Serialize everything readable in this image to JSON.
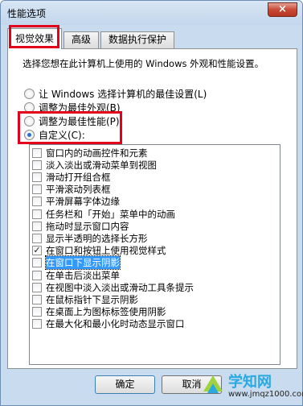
{
  "window": {
    "title": "性能选项",
    "close_label": "×"
  },
  "tabs": [
    "视觉效果",
    "高级",
    "数据执行保护"
  ],
  "panel": {
    "description": "选择您想在此计算机上使用的 Windows 外观和性能设置。",
    "radios": [
      {
        "label": "让 Windows 选择计算机的最佳设置(L)",
        "checked": false
      },
      {
        "label": "调整为最佳外观(B)",
        "checked": false
      },
      {
        "label": "调整为最佳性能(P)",
        "checked": false
      },
      {
        "label": "自定义(C):",
        "checked": true
      }
    ],
    "options": [
      {
        "label": "窗口内的动画控件和元素",
        "checked": false
      },
      {
        "label": "淡入淡出或滑动菜单到视图",
        "checked": false
      },
      {
        "label": "滑动打开组合框",
        "checked": false
      },
      {
        "label": "平滑滚动列表框",
        "checked": false
      },
      {
        "label": "平滑屏幕字体边缘",
        "checked": false
      },
      {
        "label": "任务栏和「开始」菜单中的动画",
        "checked": false
      },
      {
        "label": "拖动时显示窗口内容",
        "checked": false
      },
      {
        "label": "显示半透明的选择长方形",
        "checked": false
      },
      {
        "label": "在窗口和按钮上使用视觉样式",
        "checked": true
      },
      {
        "label": "在窗口下显示阴影",
        "checked": false,
        "selected": true
      },
      {
        "label": "在单击后淡出菜单",
        "checked": false
      },
      {
        "label": "在视图中淡入淡出或滑动工具条提示",
        "checked": false
      },
      {
        "label": "在鼠标指针下显示阴影",
        "checked": false
      },
      {
        "label": "在桌面上为图标标签使用阴影",
        "checked": false
      },
      {
        "label": "在最大化和最小化时动态显示窗口",
        "checked": false
      }
    ]
  },
  "buttons": {
    "ok": "确定",
    "cancel": "取消"
  },
  "watermark": {
    "name": "学知网",
    "url": "www.jmqz1000.com"
  },
  "colors": {
    "annotation": "#e3001b",
    "selection": "#3399ff"
  }
}
